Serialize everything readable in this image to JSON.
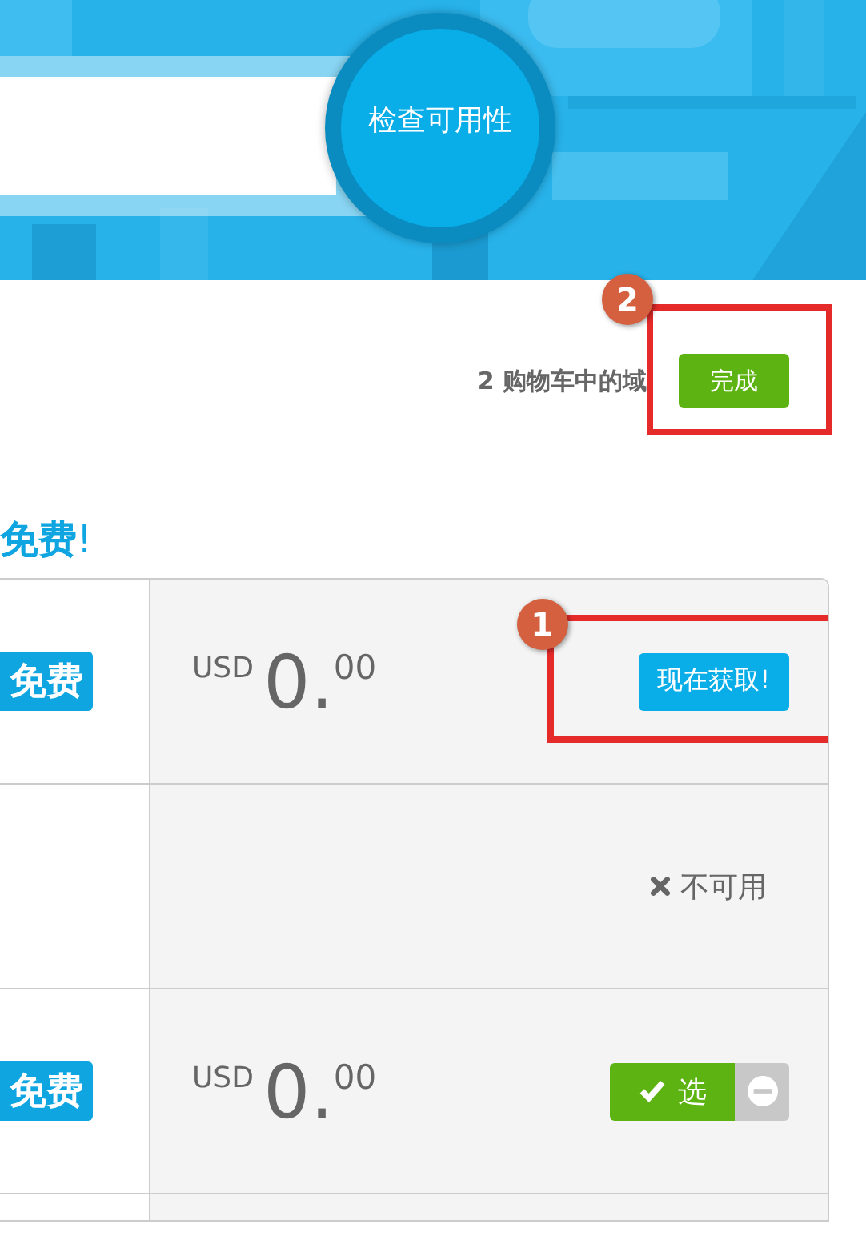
{
  "hero": {
    "search": {
      "button": "检查可用性"
    }
  },
  "cart": {
    "count_text": "2 购物车中的域",
    "button": "完成",
    "annotation": "2"
  },
  "heading": "**免费**!",
  "rows": [
    {
      "tag": "免费",
      "price": {
        "currency": "USD",
        "whole": "0.",
        "cents": "00"
      },
      "action": {
        "kind": "get",
        "label": "现在获取!"
      },
      "annotation": "1"
    },
    {
      "action": {
        "kind": "unavailable",
        "label": "不可用"
      }
    },
    {
      "tag": "免费",
      "price": {
        "currency": "USD",
        "whole": "0.",
        "cents": "00"
      },
      "action": {
        "kind": "select",
        "label": "选",
        "selected": true
      }
    },
    {}
  ]
}
